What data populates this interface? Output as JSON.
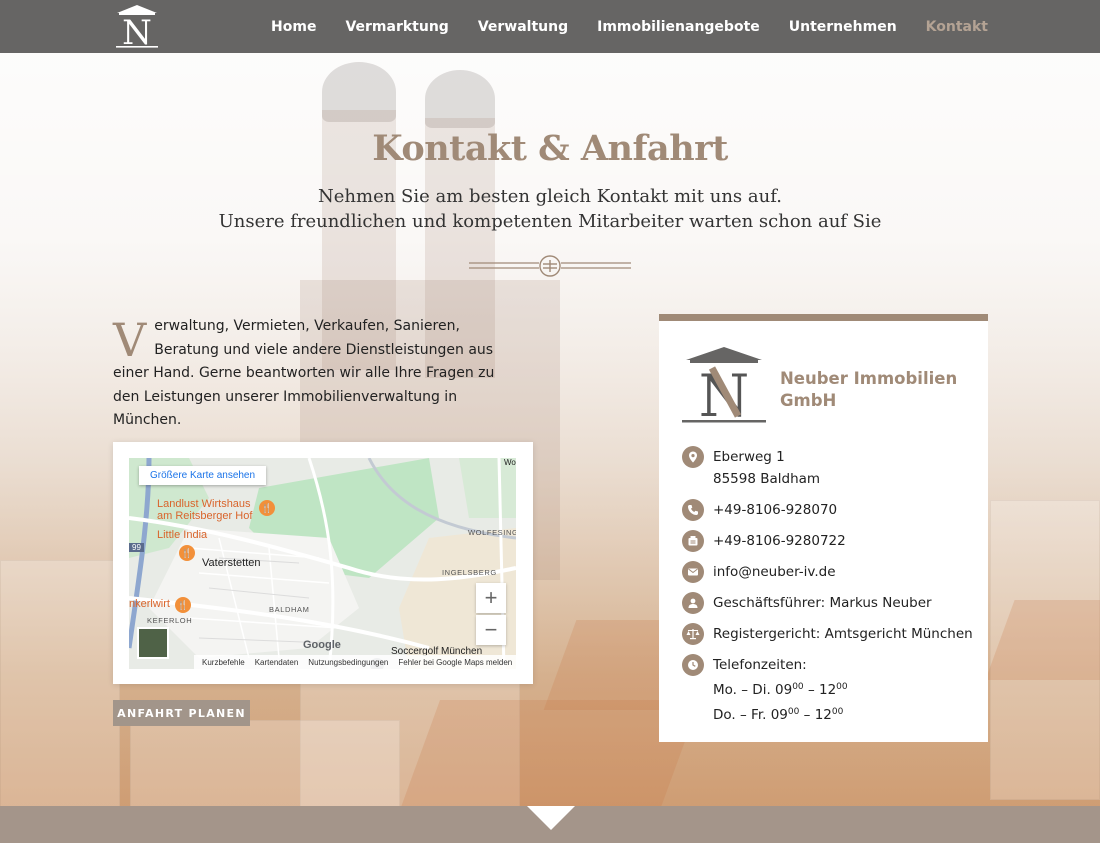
{
  "header": {
    "logo_letter": "N",
    "nav": [
      {
        "label": "Home"
      },
      {
        "label": "Vermarktung"
      },
      {
        "label": "Verwaltung"
      },
      {
        "label": "Immobilienangebote"
      },
      {
        "label": "Unternehmen"
      },
      {
        "label": "Kontakt",
        "active": true
      }
    ]
  },
  "hero": {
    "title": "Kontakt & Anfahrt",
    "subtitle_line1": "Nehmen Sie am besten gleich Kontakt mit uns auf.",
    "subtitle_line2": "Unsere freundlichen und kompetenten Mitarbeiter warten schon auf Sie"
  },
  "intro": {
    "dropcap": "V",
    "text": "erwaltung, Vermieten, Verkaufen, Sanieren, Beratung und viele andere Dienstleistungen aus einer Hand. Gerne beantworten wir alle Ihre Fragen zu den Leistungen unserer Immobilienverwaltung in München."
  },
  "map": {
    "larger_map_link": "Größere Karte ansehen",
    "pois": [
      "Landlust Wirtshaus",
      "am Reitsberger Hof",
      "Little India",
      "nkerlwirt"
    ],
    "places": [
      "Vaterstetten",
      "BALDHAM",
      "WOLFESING",
      "INGELSBERG",
      "KEFERLOH",
      "Soccergolf München"
    ],
    "route_number": "99",
    "road_label": "Wo",
    "zoom_in": "+",
    "zoom_out": "−",
    "google": "Google",
    "footer": [
      "Kurzbefehle",
      "Kartendaten",
      "Nutzungsbedingungen",
      "Fehler bei Google Maps melden"
    ]
  },
  "route_button": "ANFAHRT PLANEN",
  "contact": {
    "company_line1": "Neuber Immobilien",
    "company_line2": "GmbH",
    "logo_letter": "N",
    "street": "Eberweg 1",
    "city": "85598 Baldham",
    "phone": "+49-8106-928070",
    "fax": "+49-8106-9280722",
    "email": "info@neuber-iv.de",
    "manager": "Geschäftsführer: Markus Neuber",
    "register": "Registergericht: Amtsgericht München",
    "hours_label": "Telefonzeiten:",
    "hours_1_days": "Mo. – Di. 09",
    "hours_1_from_sup": "00",
    "hours_1_to": " – 12",
    "hours_1_to_sup": "00",
    "hours_2_days": "Do. – Fr. 09",
    "hours_2_from_sup": "00",
    "hours_2_to": " – 12",
    "hours_2_to_sup": "00"
  },
  "colors": {
    "accent": "#a08a77",
    "topbar": "#666564",
    "nav_active": "#b4a394",
    "button": "#a2958a",
    "bottom_band": "#a4958a"
  },
  "icons": [
    "logo-icon",
    "divider-icon",
    "location-icon",
    "phone-icon",
    "fax-icon",
    "email-icon",
    "person-icon",
    "scales-icon",
    "clock-icon",
    "restaurant-icon"
  ]
}
